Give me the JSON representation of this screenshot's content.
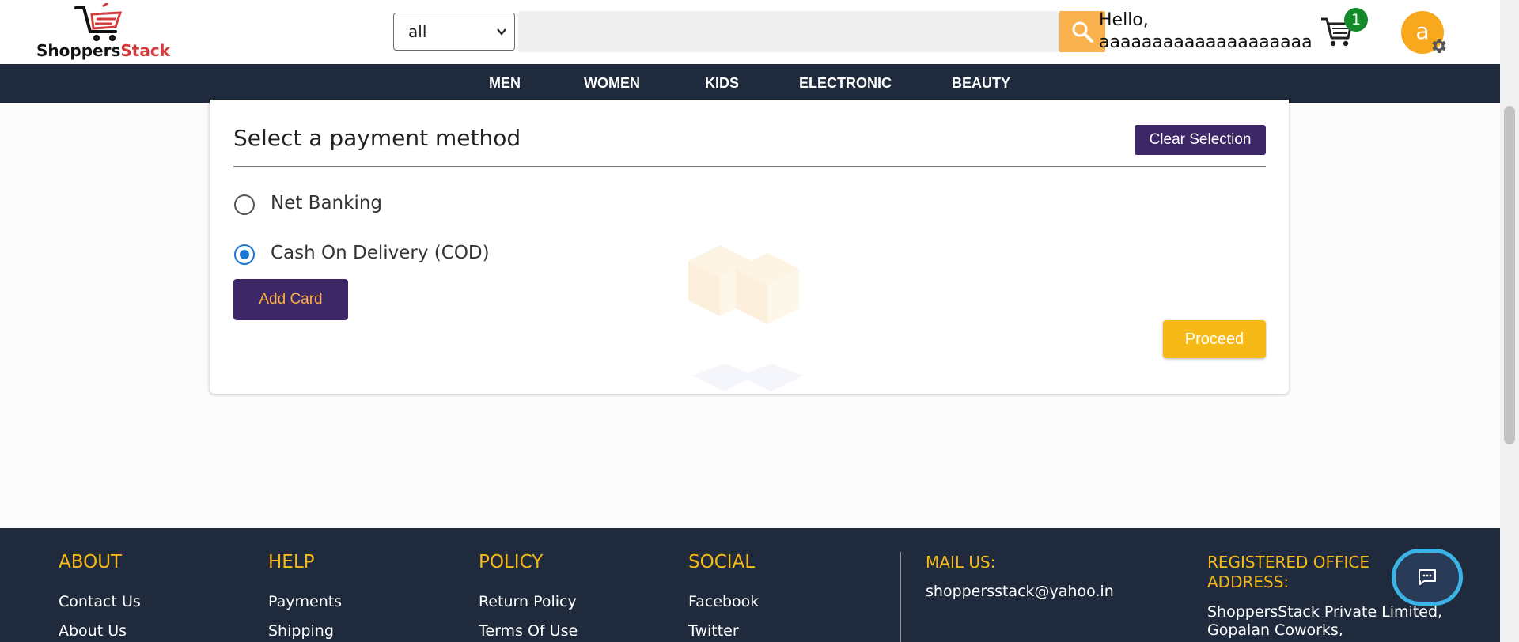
{
  "header": {
    "logo": {
      "part1": "Shoppers",
      "part2": "Stack"
    },
    "category_select": {
      "value": "all"
    },
    "search": {
      "placeholder": ""
    },
    "greeting": {
      "line1": "Hello,",
      "line2": "aaaaaaaaaaaaaaaaaaaa"
    },
    "cart_count": "1",
    "avatar_letter": "a"
  },
  "nav": {
    "items": [
      "MEN",
      "WOMEN",
      "KIDS",
      "ELECTRONIC",
      "BEAUTY"
    ]
  },
  "payment": {
    "title": "Select a payment method",
    "clear_label": "Clear Selection",
    "options": [
      {
        "label": "Net Banking",
        "selected": false
      },
      {
        "label": "Cash On Delivery (COD)",
        "selected": true
      }
    ],
    "add_card_label": "Add Card",
    "proceed_label": "Proceed"
  },
  "footer": {
    "about": {
      "heading": "ABOUT",
      "links": [
        "Contact Us",
        "About Us"
      ]
    },
    "help": {
      "heading": "HELP",
      "links": [
        "Payments",
        "Shipping"
      ]
    },
    "policy": {
      "heading": "POLICY",
      "links": [
        "Return Policy",
        "Terms Of Use"
      ]
    },
    "social": {
      "heading": "SOCIAL",
      "links": [
        "Facebook",
        "Twitter"
      ]
    },
    "mail": {
      "heading": "MAIL US:",
      "email": "shoppersstack@yahoo.in"
    },
    "office": {
      "heading_line1": "REGISTERED OFFICE",
      "heading_line2": "ADDRESS:",
      "address_line1": "ShoppersStack Private Limited,",
      "address_line2": "Gopalan Coworks,"
    }
  },
  "colors": {
    "nav_bg": "#1f2b3d",
    "primary_purple": "#3e2767",
    "accent_yellow": "#f7b916",
    "radio_blue": "#1976d2",
    "badge_green": "#128a2a"
  }
}
